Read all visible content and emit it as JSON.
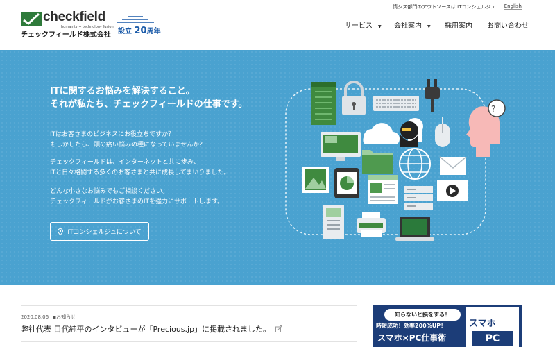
{
  "header": {
    "logo_word": "checkfield",
    "logo_tagline": "humanity + technology fusion",
    "logo_jp": "チェックフィールド株式会社",
    "anniversary_prefix": "設立",
    "anniversary_number": "20",
    "anniversary_suffix": "周年",
    "toplink_main": "情シス部門のアウトソースは ITコンシェルジュ",
    "toplink_english": "English",
    "nav": [
      {
        "label": "サービス"
      },
      {
        "label": "会社案内"
      },
      {
        "label": "採用案内"
      },
      {
        "label": "お問い合わせ"
      }
    ],
    "caret": "▼"
  },
  "hero": {
    "title_line1": "ITに関するお悩みを解決すること。",
    "title_line2": "それが私たち、チェックフィールドの仕事です。",
    "p1_line1": "ITはお客さまのビジネスにお役立ちですか？",
    "p1_line2": "もしかしたら、頭の痛い悩みの種になっていませんか？",
    "p2_line1": "チェックフィールドは、インターネットと共に歩み、",
    "p2_line2": "ITと日々格闘する多くのお客さまと共に成長してまいりました。",
    "p3_line1": "どんな小さなお悩みでもご相談ください。",
    "p3_line2": "チェックフィールドがお客さまのITを強力にサポートします。",
    "button_label": "ITコンシェルジュについて"
  },
  "news": {
    "date": "2020.08.06",
    "category": "お知らせ",
    "title": "弊社代表 目代純平のインタビューが「Precious.jp」に掲載されました。"
  },
  "banner": {
    "bubble": "知らないと損をする！",
    "sub": "時短成功！効率200%UP！",
    "main": "スマホ×PC仕事術",
    "book_top": "スマホ",
    "book_bottom": "PC"
  },
  "colors": {
    "hero_bg": "#4aa2d0",
    "brand_green": "#2e7a3a",
    "anniversary_blue": "#1a5aa8",
    "banner_navy": "#1c3d78"
  }
}
